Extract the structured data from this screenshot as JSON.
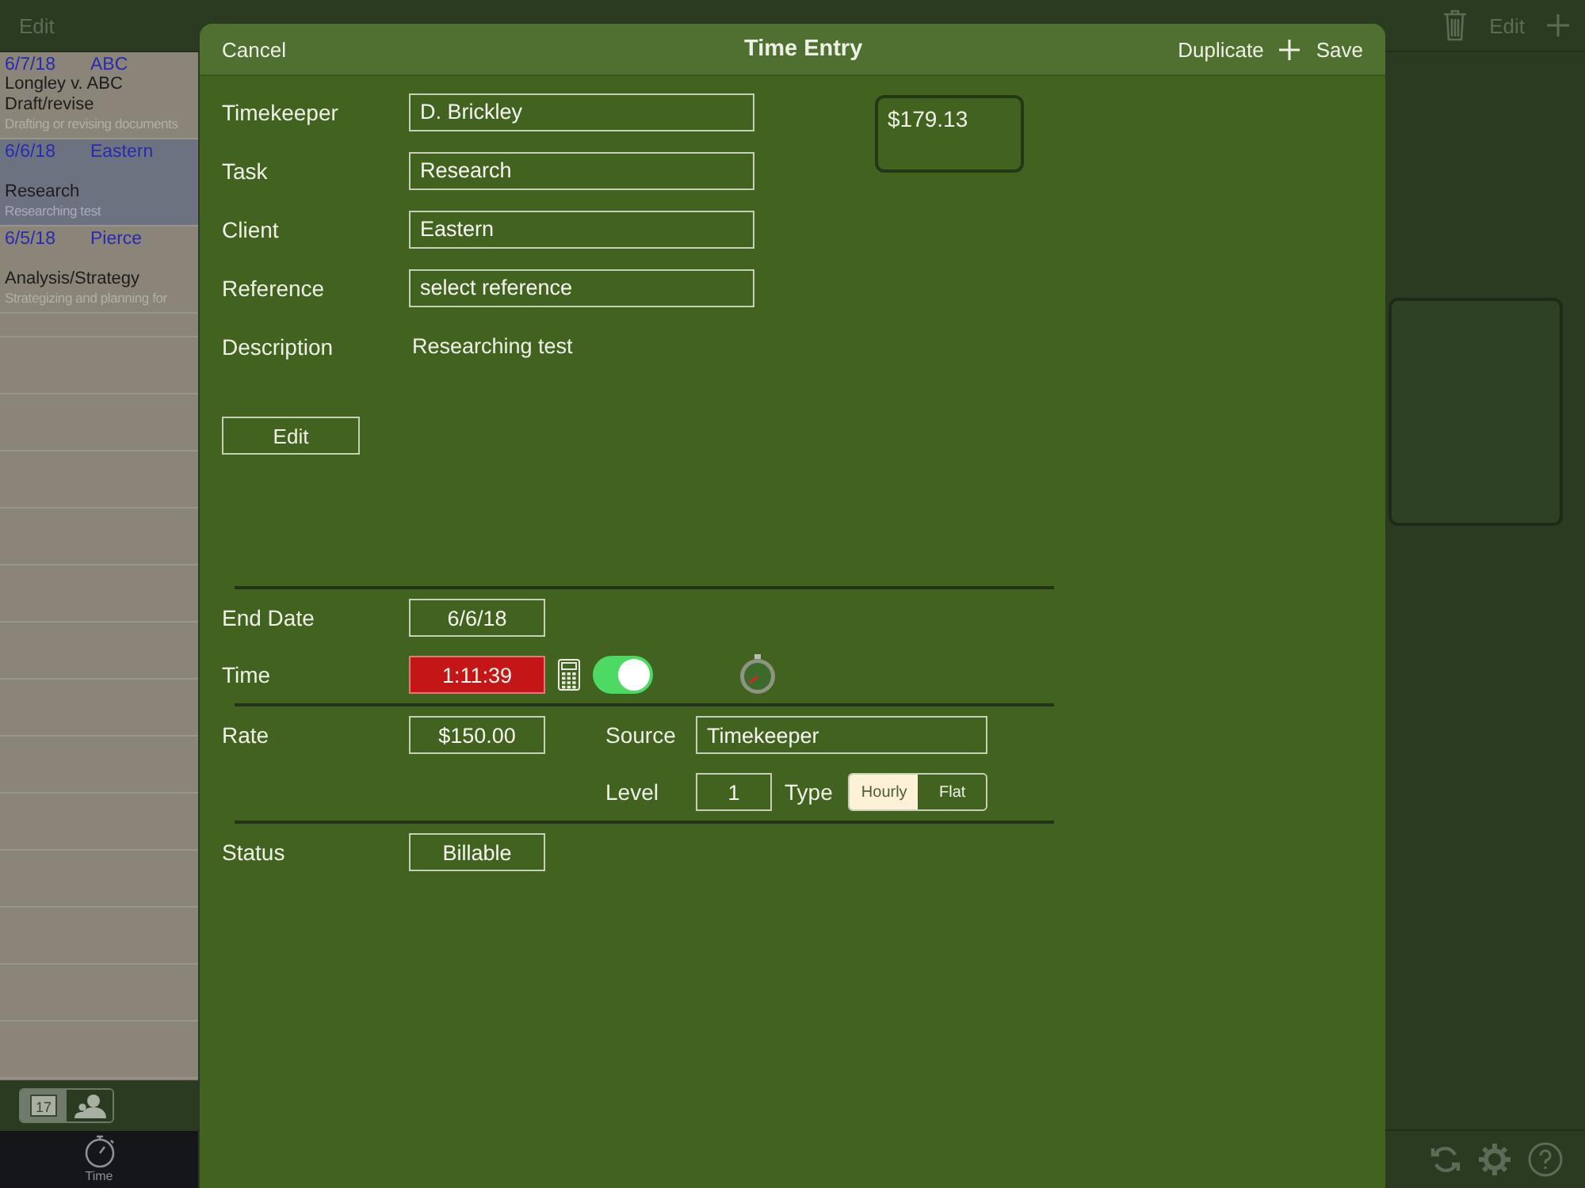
{
  "list_header": {
    "edit": "Edit"
  },
  "list": [
    {
      "date": "6/7/18",
      "client": "ABC",
      "matter": "Longley v. ABC",
      "task": "Draft/revise",
      "description": "Drafting or revising documents",
      "selected": false
    },
    {
      "date": "6/6/18",
      "client": "Eastern",
      "task": "Research",
      "description": "Researching test",
      "selected": true
    },
    {
      "date": "6/5/18",
      "client": "Pierce",
      "task": "Analysis/Strategy",
      "description": "Strategizing and planning for",
      "selected": false
    }
  ],
  "list_toolbar": {
    "segments": [
      {
        "kind": "calendar",
        "label": "17",
        "selected": true
      },
      {
        "kind": "people",
        "selected": false
      }
    ]
  },
  "tab_bar": [
    {
      "label": "Time",
      "selected": true
    }
  ],
  "detail_header": {
    "edit": "Edit"
  },
  "modal": {
    "cancel": "Cancel",
    "title": "Time Entry",
    "duplicate": "Duplicate",
    "save": "Save",
    "amount": "$179.13",
    "fields": [
      {
        "label": "Timekeeper",
        "value": "D. Brickley",
        "kind": "input"
      },
      {
        "label": "Task",
        "value": "Research",
        "kind": "input"
      },
      {
        "label": "Client",
        "value": "Eastern",
        "kind": "input"
      },
      {
        "label": "Reference",
        "value": "select reference",
        "kind": "input"
      },
      {
        "label": "Description",
        "value": "Researching test",
        "kind": "text"
      }
    ],
    "edit_button": "Edit",
    "end_date": {
      "label": "End Date",
      "value": "6/6/18"
    },
    "time": {
      "label": "Time",
      "value": "1:11:39",
      "running": true,
      "timer_on": true
    },
    "rate": {
      "label": "Rate",
      "value": "$150.00",
      "source_label": "Source",
      "source": "Timekeeper",
      "level_label": "Level",
      "level_value": "1",
      "type_label": "Type",
      "types": [
        {
          "label": "Hourly",
          "selected": true
        },
        {
          "label": "Flat",
          "selected": false
        }
      ]
    },
    "status": {
      "label": "Status",
      "value": "Billable"
    }
  }
}
